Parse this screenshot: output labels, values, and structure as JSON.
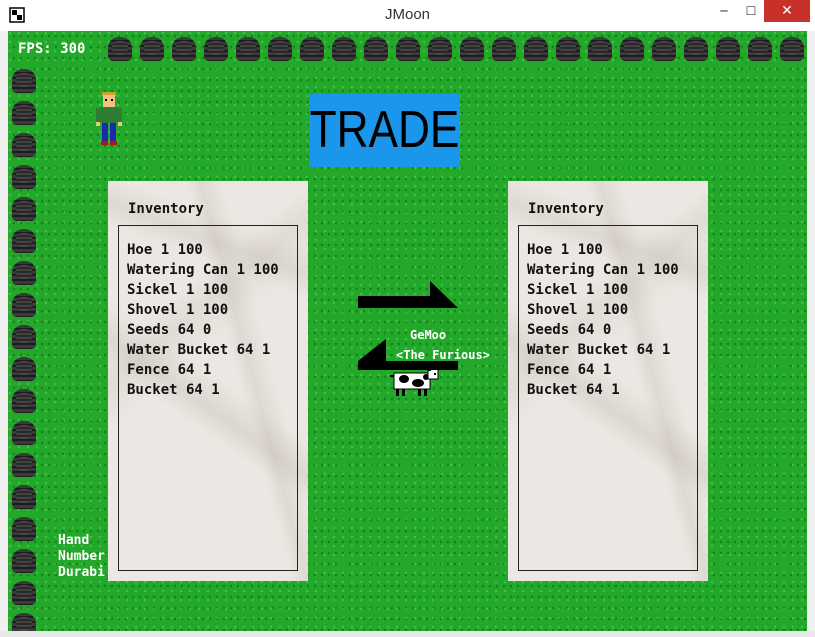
{
  "window": {
    "title": "JMoon",
    "minimize_glyph": "─",
    "maximize_glyph": "☐",
    "close_glyph": "✕"
  },
  "hud": {
    "fps_text": "FPS: 300",
    "hand_info": [
      "Hand",
      "Number",
      "Durabi"
    ]
  },
  "trade": {
    "title": "TRADE",
    "left_panel": {
      "title": "Inventory",
      "items": [
        "Hoe 1 100",
        "Watering Can 1 100",
        "Sickel 1 100",
        "Shovel 1 100",
        "Seeds 64 0",
        "Water Bucket 64 1",
        "Fence 64 1",
        "Bucket 64 1"
      ]
    },
    "right_panel": {
      "title": "Inventory",
      "items": [
        "Hoe 1 100",
        "Watering Can 1 100",
        "Sickel 1 100",
        "Shovel 1 100",
        "Seeds 64 0",
        "Water Bucket 64 1",
        "Fence 64 1",
        "Bucket 64 1"
      ]
    }
  },
  "npc": {
    "name": "GeMoo",
    "title": "<The Furious>"
  },
  "icons": [
    "app-icon",
    "rock-icon",
    "farmer-sprite",
    "cow-sprite",
    "arrow-right-icon",
    "arrow-left-icon"
  ],
  "colors": {
    "grass": "#22a92a",
    "trade_banner": "#1a97ea",
    "panel": "#ece7e2",
    "close_button": "#c7312a"
  }
}
